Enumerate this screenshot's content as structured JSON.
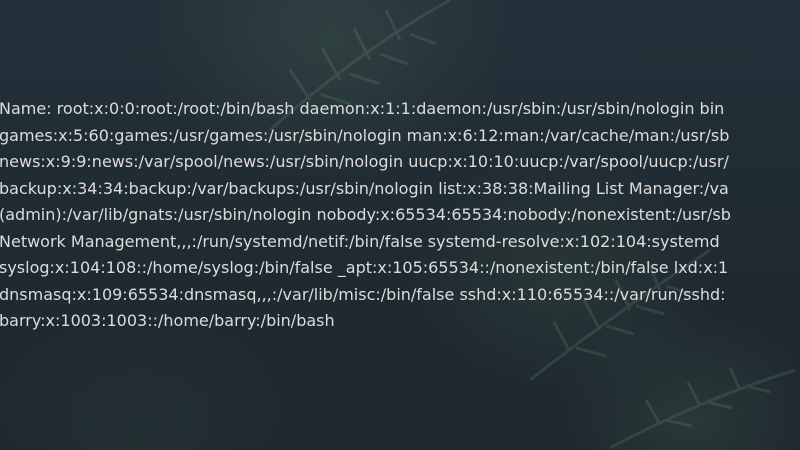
{
  "passwd_lines": [
    "Name: root:x:0:0:root:/root:/bin/bash daemon:x:1:1:daemon:/usr/sbin:/usr/sbin/nologin bin",
    "games:x:5:60:games:/usr/games:/usr/sbin/nologin man:x:6:12:man:/var/cache/man:/usr/sb",
    "news:x:9:9:news:/var/spool/news:/usr/sbin/nologin uucp:x:10:10:uucp:/var/spool/uucp:/usr/",
    "backup:x:34:34:backup:/var/backups:/usr/sbin/nologin list:x:38:38:Mailing List Manager:/va",
    "(admin):/var/lib/gnats:/usr/sbin/nologin nobody:x:65534:65534:nobody:/nonexistent:/usr/sb",
    "Network Management,,,:/run/systemd/netif:/bin/false systemd-resolve:x:102:104:systemd",
    "syslog:x:104:108::/home/syslog:/bin/false _apt:x:105:65534::/nonexistent:/bin/false lxd:x:1",
    "dnsmasq:x:109:65534:dnsmasq,,,:/var/lib/misc:/bin/false sshd:x:110:65534::/var/run/sshd:",
    "barry:x:1003:1003::/home/barry:/bin/bash"
  ],
  "colors": {
    "text": "#dcdcdc",
    "background": "#1f2b33"
  }
}
